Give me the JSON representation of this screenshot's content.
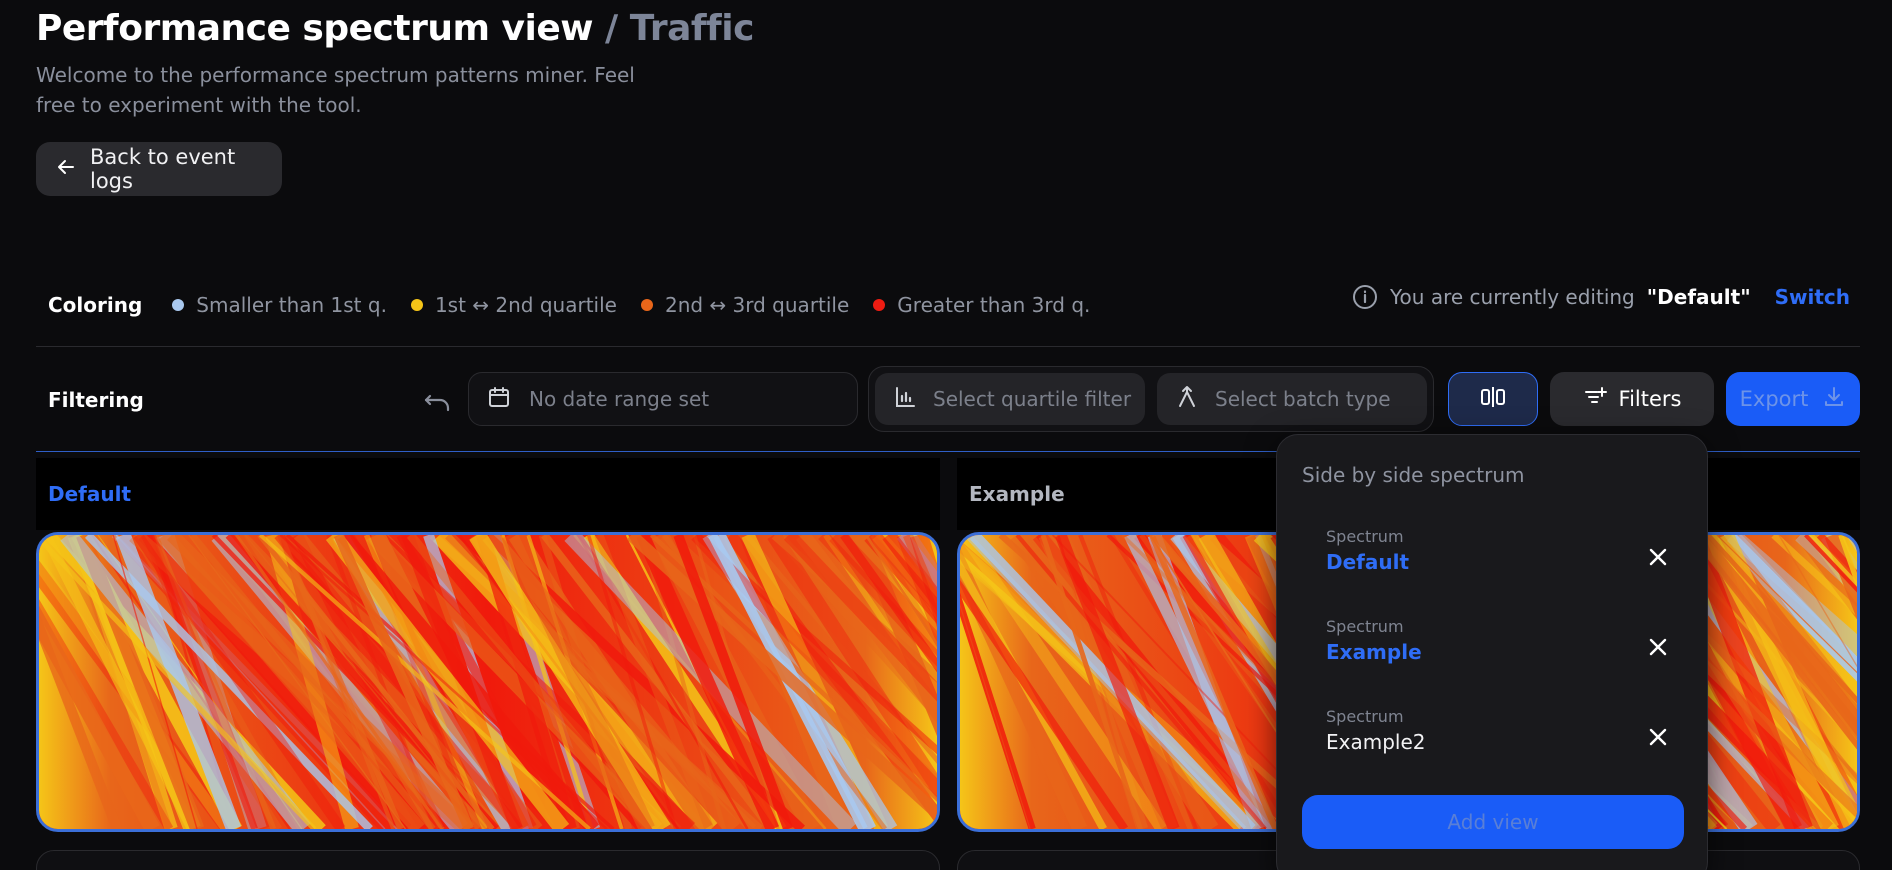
{
  "header": {
    "title": "Performance spectrum view",
    "separator": "/",
    "subtitle": "Traffic",
    "welcome": "Welcome to the performance spectrum patterns miner. Feel free to experiment with the tool.",
    "back_label": "Back to event logs"
  },
  "coloring": {
    "title": "Coloring",
    "legend": [
      {
        "label": "Smaller than 1st q.",
        "color": "#a9c8ee"
      },
      {
        "label": "1st ↔ 2nd quartile",
        "color": "#f5c518"
      },
      {
        "label": "2nd ↔ 3rd quartile",
        "color": "#e8661a"
      },
      {
        "label": "Greater than 3rd q.",
        "color": "#ee1c12"
      }
    ]
  },
  "editing": {
    "prefix": "You are currently editing",
    "name": "\"Default\"",
    "switch_label": "Switch"
  },
  "filtering": {
    "title": "Filtering",
    "date_placeholder": "No date range set",
    "quartile_placeholder": "Select quartile filter",
    "batch_placeholder": "Select batch type",
    "filters_label": "Filters",
    "export_label": "Export"
  },
  "panels": [
    {
      "name": "Default",
      "active": true
    },
    {
      "name": "Example",
      "active": false
    }
  ],
  "popover": {
    "title": "Side by side spectrum",
    "items": [
      {
        "label": "Spectrum",
        "name": "Default",
        "active": true
      },
      {
        "label": "Spectrum",
        "name": "Example",
        "active": true
      },
      {
        "label": "Spectrum",
        "name": "Example2",
        "active": false
      }
    ],
    "add_label": "Add view"
  },
  "colors": {
    "accent": "#2f6df6",
    "red": "#f01a0c",
    "orange": "#e8661a",
    "yellow": "#f5c518",
    "blue": "#a9c8ee"
  }
}
